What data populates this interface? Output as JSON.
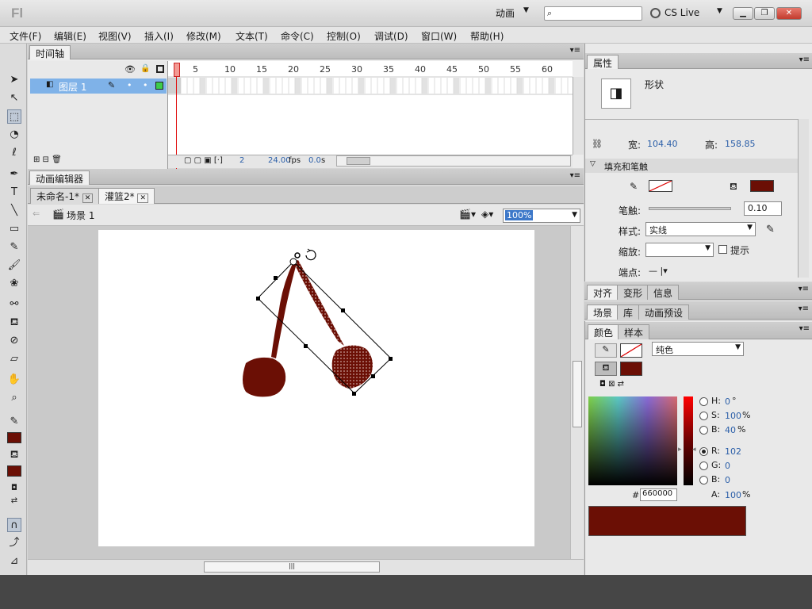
{
  "app": {
    "logo": "Fl",
    "workspace": "动画",
    "cs_live": "CS Live",
    "search_placeholder": ""
  },
  "menu": [
    "文件(F)",
    "编辑(E)",
    "视图(V)",
    "插入(I)",
    "修改(M)",
    "文本(T)",
    "命令(C)",
    "控制(O)",
    "调试(D)",
    "窗口(W)",
    "帮助(H)"
  ],
  "timeline": {
    "tab": "时间轴",
    "layer_name": "图层 1",
    "frame_numbers": [
      "5",
      "10",
      "15",
      "20",
      "25",
      "30",
      "35",
      "40",
      "45",
      "50",
      "55",
      "60"
    ],
    "current_frame": "2",
    "fps": "24.00",
    "fps_unit": "fps",
    "time": "0.0",
    "time_unit": "s"
  },
  "editor": {
    "tab": "动画编辑器",
    "doc_tabs": [
      "未命名-1*",
      "灌篮2*"
    ],
    "scene": "场景 1",
    "zoom": "100%"
  },
  "properties": {
    "tab": "属性",
    "object_type": "形状",
    "width_label": "宽:",
    "width": "104.40",
    "height_label": "高:",
    "height": "158.85",
    "section": "填充和笔触",
    "stroke_label": "笔触:",
    "stroke_value": "0.10",
    "style_label": "样式:",
    "style_value": "实线",
    "scale_label": "缩放:",
    "hint_label": "提示",
    "cap_label": "端点:"
  },
  "panels": {
    "align": "对齐",
    "transform": "变形",
    "info": "信息",
    "scene": "场景",
    "library": "库",
    "motion_presets": "动画预设",
    "color": "颜色",
    "swatches": "样本"
  },
  "color": {
    "fill_type": "纯色",
    "H_label": "H:",
    "H": "0",
    "H_unit": "°",
    "S_label": "S:",
    "S": "100",
    "S_unit": "%",
    "B_label": "B:",
    "B": "40",
    "B_unit": "%",
    "R_label": "R:",
    "R": "102",
    "G_label": "G:",
    "G": "0",
    "Bl_label": "B:",
    "Bl": "0",
    "A_label": "A:",
    "A": "100",
    "A_unit": "%",
    "hex_label": "#",
    "hex": "660000",
    "swatch_color": "#6b0f05"
  }
}
